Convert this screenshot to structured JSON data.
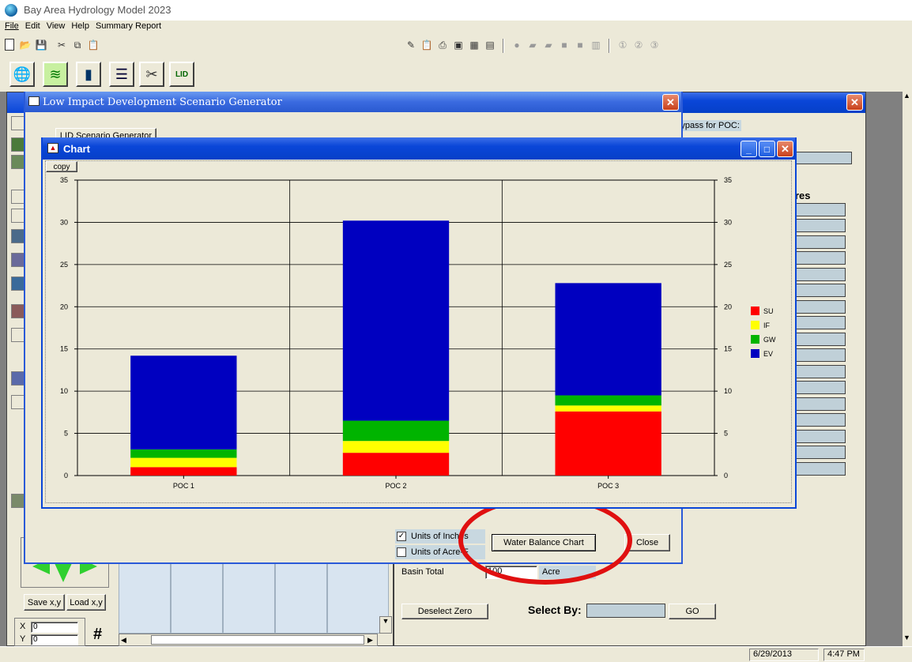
{
  "app": {
    "title": "Bay Area Hydrology Model 2023",
    "menu": [
      "File",
      "Edit",
      "View",
      "Help",
      "Summary Report"
    ]
  },
  "toolbar": {
    "icons": [
      "new-icon",
      "open-icon",
      "save-icon",
      "cut-icon",
      "copy-icon",
      "paste-icon"
    ],
    "right_icons": [
      "edit-icon",
      "clipboard-icon",
      "print-icon",
      "save-icon",
      "table-icon",
      "chart-icon",
      "circle-icon",
      "folder-icon",
      "folder2-icon",
      "square-icon",
      "square2-icon",
      "graph-icon"
    ],
    "circled": [
      "①",
      "②",
      "③"
    ]
  },
  "scenario_window": {
    "title": "Low Impact Development Scenario Generator",
    "button_partial": "LID Scenario Generator"
  },
  "back_panel": {
    "bypass_label": "Bypass for POC:",
    "heading_partial": "res",
    "units_inches": "Units of Inches",
    "units_acre": "Units of Acre-F",
    "water_balance_btn": "Water Balance Chart",
    "close_btn": "Close",
    "basin_total_label": "Basin Total",
    "basin_total_value": "100",
    "acres_partial": "Acre",
    "deselect_zero": "Deselect Zero",
    "select_by_label": "Select By:",
    "go_btn": "GO"
  },
  "left_panel": {
    "save_xy": "Save x,y",
    "load_xy": "Load x,y",
    "x_label": "X",
    "x_value": "0",
    "y_label": "Y",
    "y_value": "0"
  },
  "chart_window": {
    "title": "Chart",
    "copy_btn": "copy"
  },
  "chart_data": {
    "type": "bar",
    "stacked": true,
    "categories": [
      "POC 1",
      "POC 2",
      "POC 3"
    ],
    "series": [
      {
        "name": "SU",
        "color": "#ff0000",
        "values": [
          1.0,
          2.7,
          7.6
        ]
      },
      {
        "name": "IF",
        "color": "#ffff00",
        "values": [
          1.1,
          1.4,
          0.7
        ]
      },
      {
        "name": "GW",
        "color": "#00b400",
        "values": [
          1.0,
          2.4,
          1.2
        ]
      },
      {
        "name": "EV",
        "color": "#0000c0",
        "values": [
          11.1,
          23.7,
          13.3
        ]
      }
    ],
    "ylim": [
      0,
      35
    ],
    "yticks": [
      0,
      5,
      10,
      15,
      20,
      25,
      30,
      35
    ],
    "grid": true,
    "legend": "right"
  },
  "status": {
    "date": "6/29/2013",
    "time": "4:47 PM"
  }
}
